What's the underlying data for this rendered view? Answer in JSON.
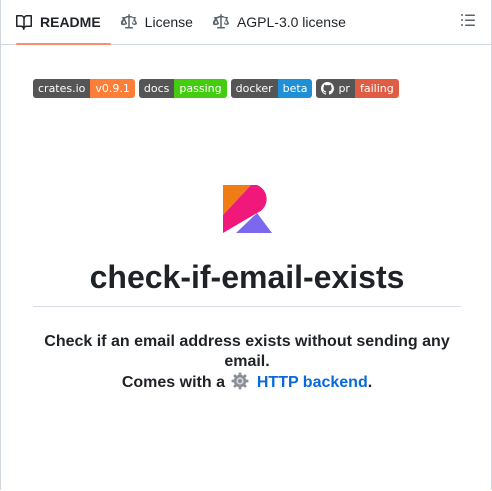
{
  "tabs": [
    {
      "label": "README",
      "icon": "book-icon",
      "active": true
    },
    {
      "label": "License",
      "icon": "scale-icon",
      "active": false
    },
    {
      "label": "AGPL-3.0 license",
      "icon": "scale-icon",
      "active": false
    }
  ],
  "badges": [
    {
      "left": "crates.io",
      "right": "v0.9.1",
      "color": "#fe7d37"
    },
    {
      "left": "docs",
      "right": "passing",
      "color": "#4c1"
    },
    {
      "left": "docker",
      "right": "beta",
      "color": "#1f8fd6"
    },
    {
      "left": "pr",
      "right": "failing",
      "color": "#e05d44",
      "icon": "github-icon"
    }
  ],
  "readme": {
    "title": "check-if-email-exists",
    "tagline_line1": "Check if an email address exists without sending any email.",
    "tagline_prefix": "Comes with a",
    "tagline_link": "HTTP backend",
    "tagline_suffix": "."
  },
  "colors": {
    "tab_underline": "#fd8c73",
    "link": "#0969da",
    "logo_orange": "#f07c16",
    "logo_pink": "#f0187a",
    "logo_purple": "#7b68ee"
  }
}
